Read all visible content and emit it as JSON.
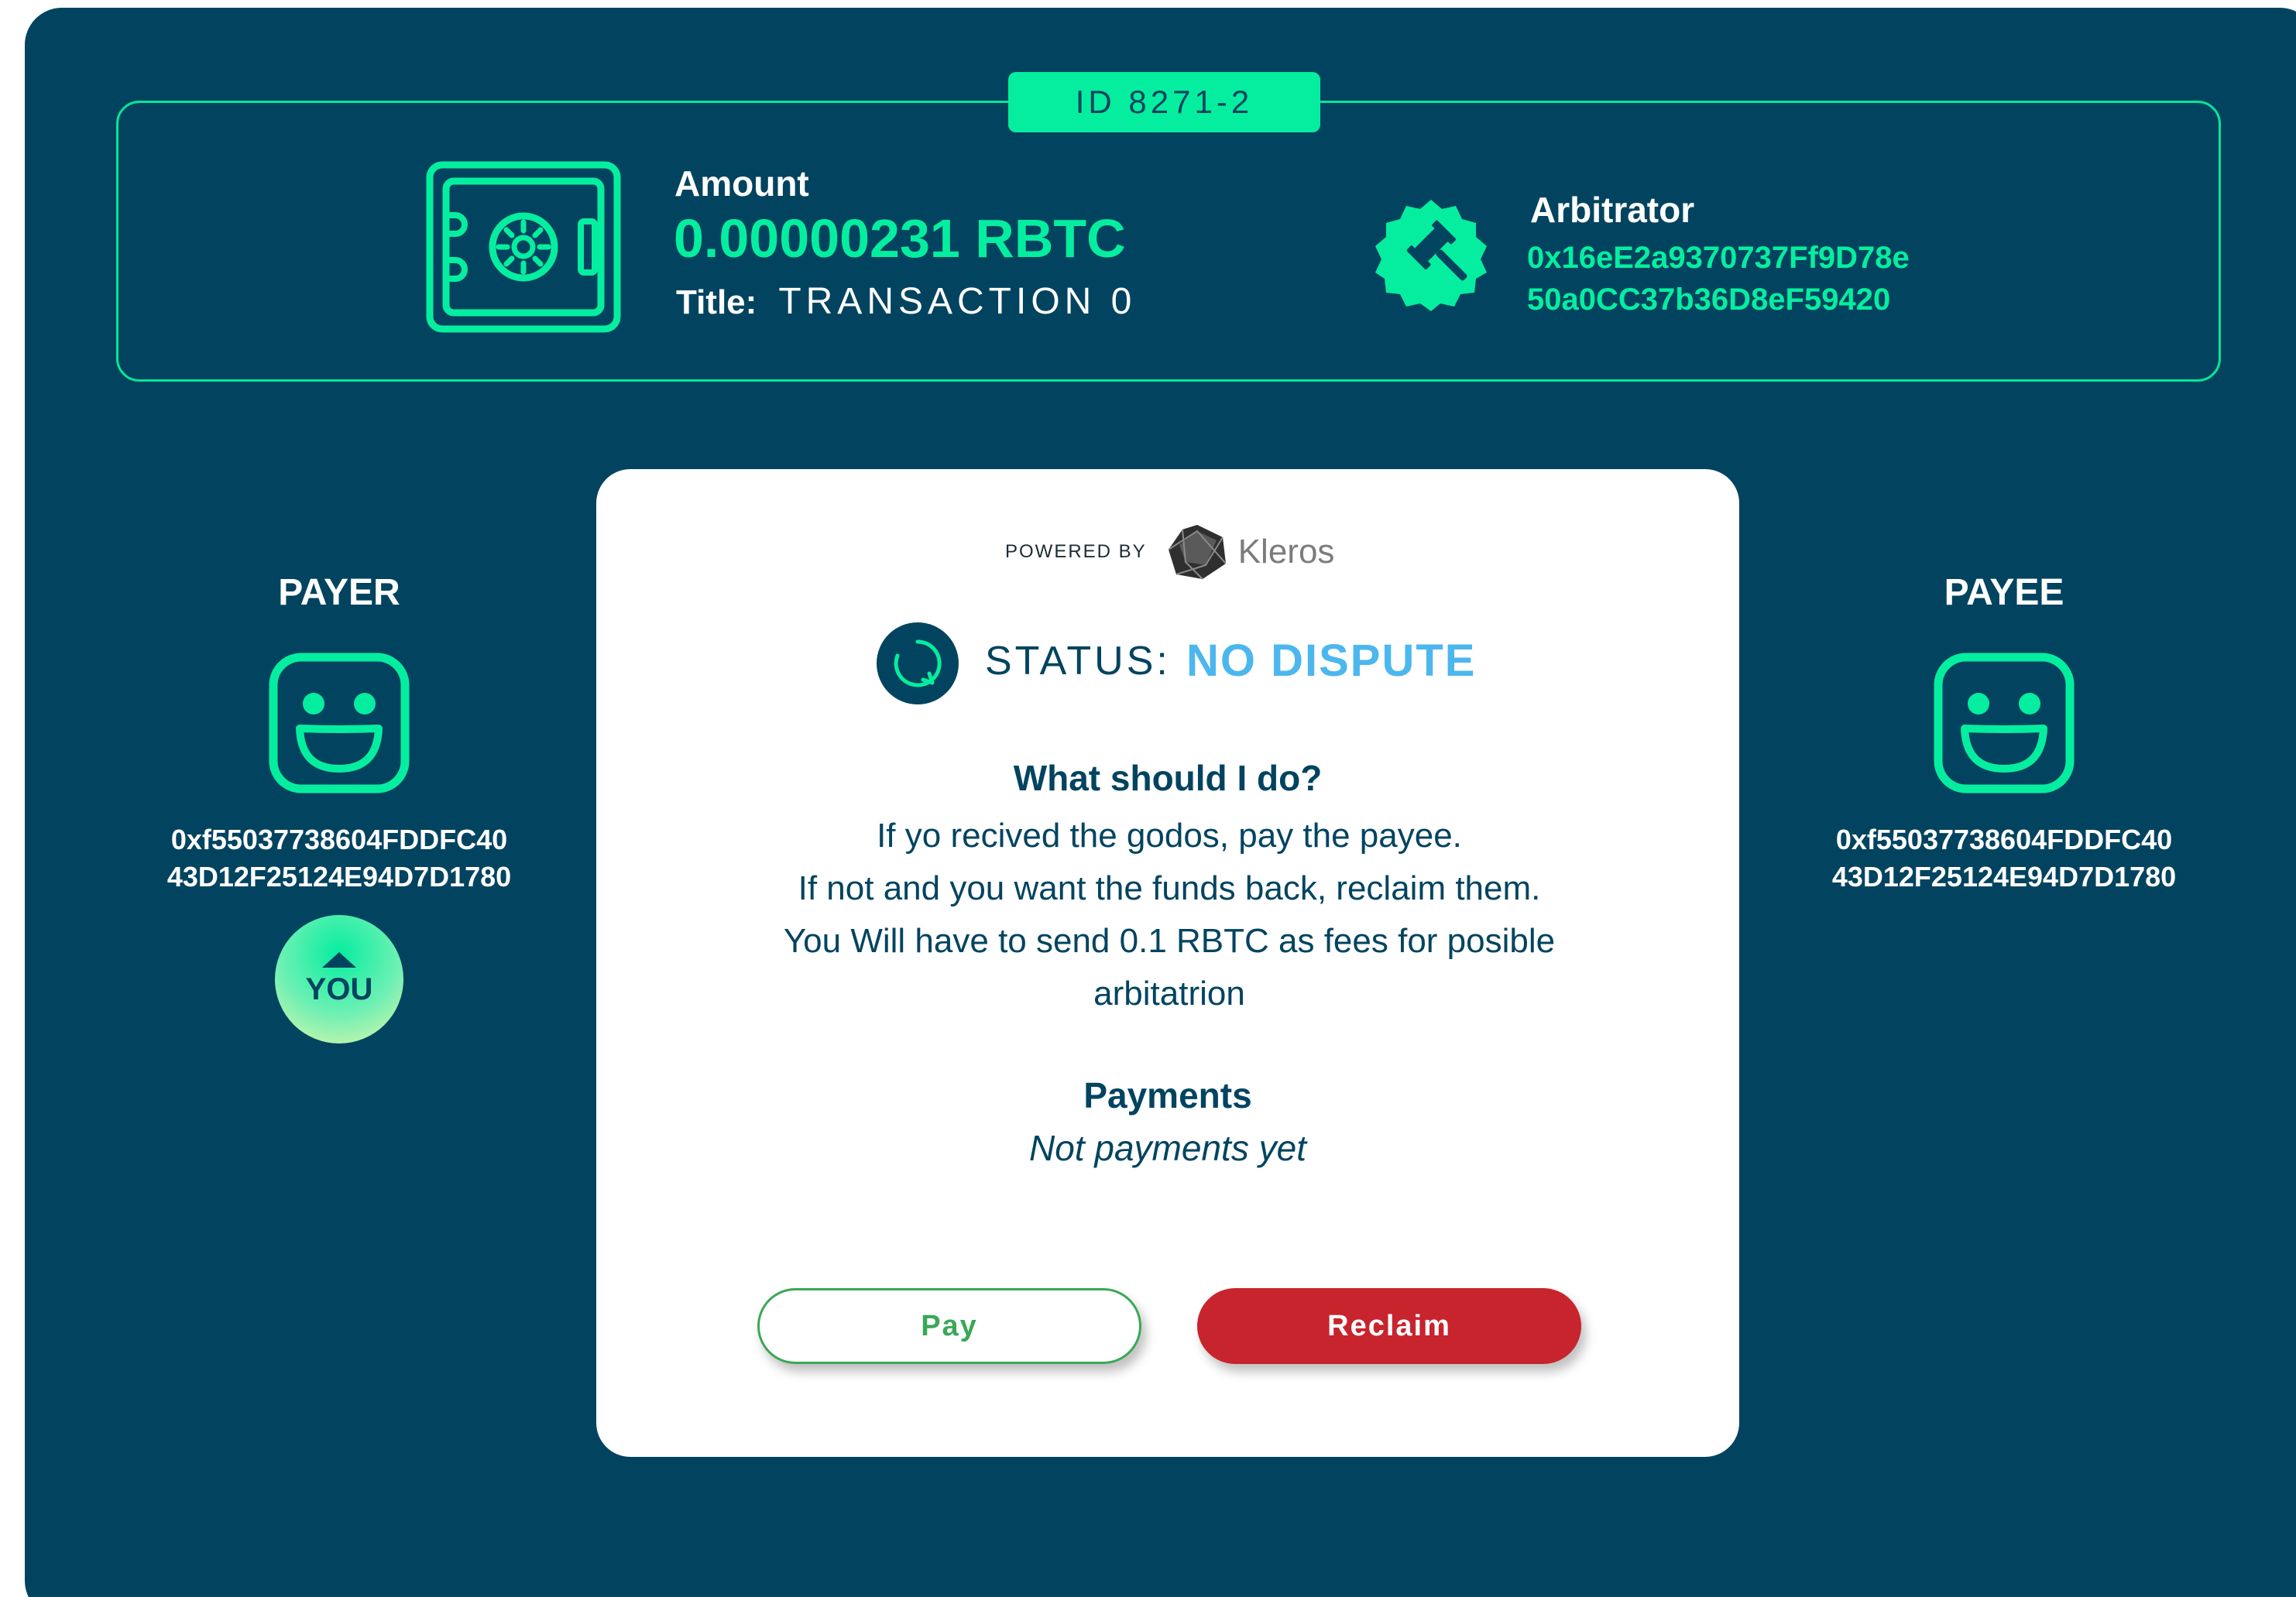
{
  "header": {
    "id_badge": "ID 8271-2",
    "amount_label": "Amount",
    "amount_value": "0.00000231 RBTC",
    "title_label": "Title:",
    "title_value": "TRANSACTION 0",
    "arbitrator_label": "Arbitrator",
    "arbitrator_address_line1": "0x16eE2a9370737Ff9D78e",
    "arbitrator_address_line2": "50a0CC37b36D8eF59420"
  },
  "payer": {
    "role": "PAYER",
    "address_line1": "0xf55037738604FDDFC40",
    "address_line2": "43D12F25124E94D7D1780",
    "you_badge": "YOU"
  },
  "payee": {
    "role": "PAYEE",
    "address_line1": "0xf55037738604FDDFC40",
    "address_line2": "43D12F25124E94D7D1780"
  },
  "card": {
    "powered_by": "POWERED BY",
    "kleros_name": "Kleros",
    "status_label": "STATUS:",
    "status_value": "NO DISPUTE",
    "what_title": "What should I do?",
    "what_lines": [
      "If yo recived the godos, pay the payee.",
      "If not and you want the funds back, reclaim them.",
      "You Will have to send 0.1 RBTC as fees for posible",
      "arbitatrion"
    ],
    "payments_title": "Payments",
    "payments_body": "Not payments yet",
    "pay_label": "Pay",
    "reclaim_label": "Reclaim"
  },
  "colors": {
    "background": "#024460",
    "accent": "#05ee9f",
    "status": "#4cb7ee",
    "reclaim": "#c8242d",
    "pay": "#3aa857"
  },
  "icons": [
    "safe-icon",
    "gavel-icon",
    "smiley-face-icon",
    "kleros-logo-icon",
    "refresh-icon",
    "arrow-up-icon"
  ]
}
